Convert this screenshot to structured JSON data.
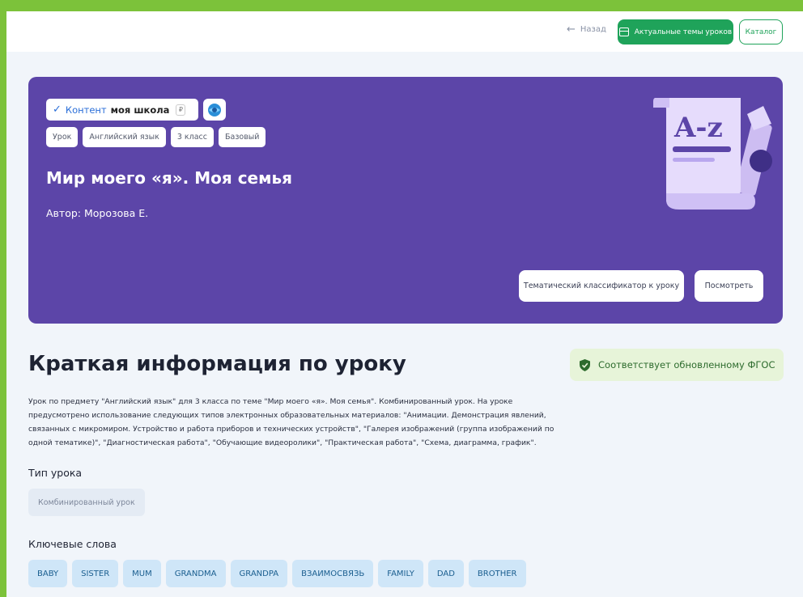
{
  "nav": {
    "back_label": "Назад",
    "topics_label": "Актуальные темы уроков",
    "catalog_label": "Каталог"
  },
  "banner": {
    "source_prefix": "Контент",
    "source_name": "моя школа",
    "source_currency": "₽",
    "tags": [
      "Урок",
      "Английский язык",
      "3 класс",
      "Базовый"
    ],
    "title": "Мир моего «я». Моя семья",
    "author": "Автор: Морозова Е.",
    "classifier_button": "Тематический классификатор к уроку",
    "view_button": "Посмотреть",
    "illustration_text": "A-z",
    "background_color": "#5c45a8"
  },
  "info": {
    "heading": "Краткая информация по уроку",
    "fgos_badge": "Соответствует обновленному ФГОС",
    "description": "Урок по предмету \"Английский язык\" для 3 класса по теме \"Мир моего «я». Моя семья\". Комбинированный урок. На уроке предусмотрено использование следующих типов электронных образовательных материалов: \"Анимации. Демонстрация явлений, связанных с микромиром. Устройство и работа приборов и технических устройств\", \"Галерея изображений (группа изображений по одной тематике)\", \"Диагностическая работа\", \"Обучающие видеоролики\", \"Практическая работа\", \"Схема, диаграмма, график\".",
    "type_label": "Тип урока",
    "type_value": "Комбинированный урок",
    "keywords_label": "Ключевые слова",
    "keywords": [
      "BABY",
      "SISTER",
      "MUM",
      "GRANDMA",
      "GRANDPA",
      "ВЗАИМОСВЯЗЬ",
      "FAMILY",
      "DAD",
      "BROTHER"
    ]
  },
  "colors": {
    "accent_green": "#1fa35a",
    "page_bg": "#f1f5fa",
    "outer_border": "#7cc23a"
  }
}
